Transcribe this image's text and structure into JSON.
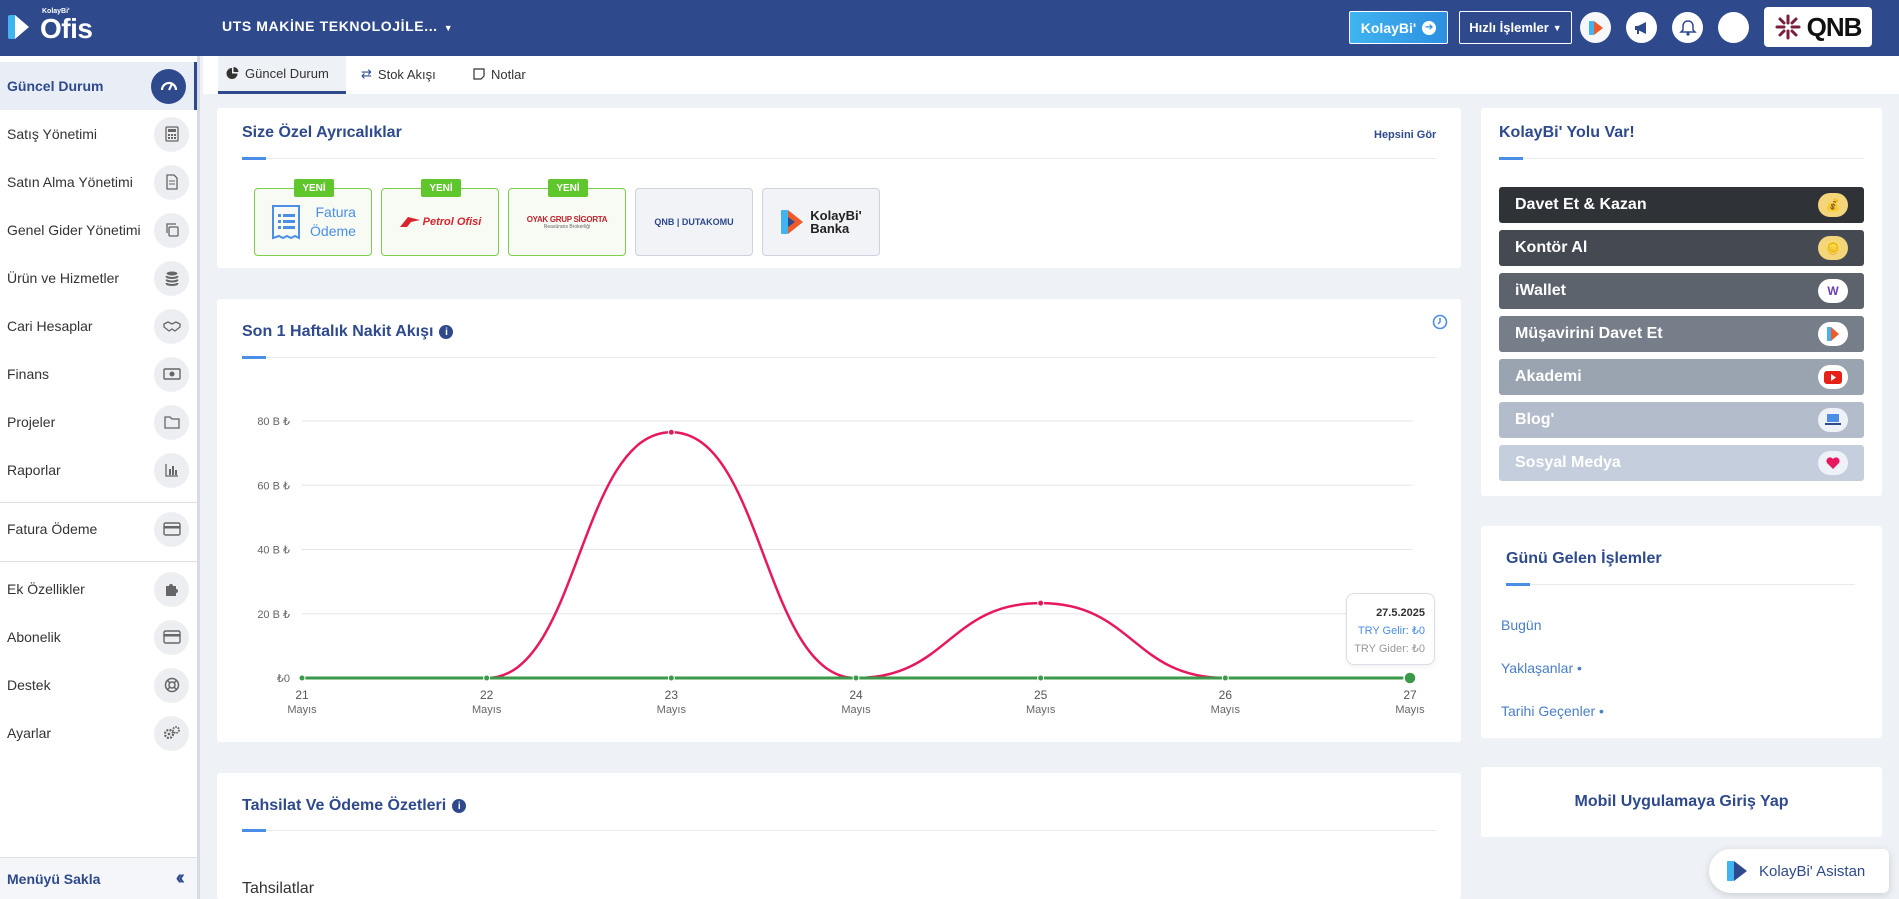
{
  "topbar": {
    "logo_small": "KolayBi'",
    "logo_big": "Ofis",
    "company": "UTS MAKİNE TEKNOLOJİLE...",
    "kolaybi_label": "KolayBi'",
    "hizli_label": "Hızlı İşlemler",
    "bank_label": "QNB"
  },
  "sidebar": {
    "items": [
      {
        "label": "Güncel Durum"
      },
      {
        "label": "Satış Yönetimi"
      },
      {
        "label": "Satın Alma Yönetimi"
      },
      {
        "label": "Genel Gider Yönetimi"
      },
      {
        "label": "Ürün ve Hizmetler"
      },
      {
        "label": "Cari Hesaplar"
      },
      {
        "label": "Finans"
      },
      {
        "label": "Projeler"
      },
      {
        "label": "Raporlar"
      },
      {
        "label": "Fatura Ödeme"
      },
      {
        "label": "Ek Özellikler"
      },
      {
        "label": "Abonelik"
      },
      {
        "label": "Destek"
      },
      {
        "label": "Ayarlar"
      }
    ],
    "hide_label": "Menüyü Sakla"
  },
  "tabs": [
    {
      "label": "Güncel Durum"
    },
    {
      "label": "Stok Akışı"
    },
    {
      "label": "Notlar"
    }
  ],
  "privileges": {
    "title": "Size Özel Ayrıcalıklar",
    "see_all": "Hepsini Gör",
    "new_badge": "YENİ",
    "fatura_line1": "Fatura",
    "fatura_line2": "Ödeme",
    "petrol": "Petrol Ofisi",
    "oyak": "OYAK GRUP SİGORTA",
    "oyak_sub": "Reasürans Brokerliği",
    "qnb": "QNB | DUTAKOMU",
    "kb_banka1": "KolayBi'",
    "kb_banka2": "Banka"
  },
  "cashflow": {
    "title": "Son 1 Haftalık Nakit Akışı",
    "tooltip_date": "27.5.2025",
    "tooltip_income": "TRY Gelir: ₺0",
    "tooltip_expense": "TRY Gider: ₺0"
  },
  "chart_data": {
    "type": "line",
    "x": [
      "21 Mayıs",
      "22 Mayıs",
      "23 Mayıs",
      "24 Mayıs",
      "25 Mayıs",
      "26 Mayıs",
      "27 Mayıs"
    ],
    "x_day": [
      "21",
      "22",
      "23",
      "24",
      "25",
      "26",
      "27"
    ],
    "x_month": "Mayıs",
    "y_ticks": [
      "₺0",
      "20 B ₺",
      "40 B ₺",
      "60 B ₺",
      "80 B ₺"
    ],
    "ylim": [
      0,
      80000
    ],
    "series": [
      {
        "name": "TRY Gider",
        "color": "#e8185f",
        "values": [
          0,
          0,
          76500,
          0,
          23300,
          0,
          0
        ]
      },
      {
        "name": "TRY Gelir",
        "color": "#3a9a4a",
        "values": [
          0,
          0,
          0,
          0,
          0,
          0,
          0
        ]
      }
    ],
    "grid": true
  },
  "summary": {
    "title": "Tahsilat Ve Ödeme Özetleri",
    "sub": "Tahsilatlar"
  },
  "kolaybi_panel": {
    "title": "KolayBi' Yolu Var!",
    "buttons": [
      {
        "label": "Davet Et & Kazan",
        "color": "#2f3338"
      },
      {
        "label": "Kontör Al",
        "color": "#454a52"
      },
      {
        "label": "iWallet",
        "color": "#5c636d"
      },
      {
        "label": "Müşavirini Davet Et",
        "color": "#767e89"
      },
      {
        "label": "Akademi",
        "color": "#9aa3b0"
      },
      {
        "label": "Blog'",
        "color": "#b2bccb"
      },
      {
        "label": "Sosyal Medya",
        "color": "#c4cedd"
      }
    ]
  },
  "today_ops": {
    "title": "Günü Gelen İşlemler",
    "links": [
      "Bugün",
      "Yaklaşanlar •",
      "Tarihi Geçenler •"
    ]
  },
  "mobile": {
    "label": "Mobil Uygulamaya Giriş Yap"
  },
  "assistant": {
    "label": "KolayBi' Asistan"
  }
}
